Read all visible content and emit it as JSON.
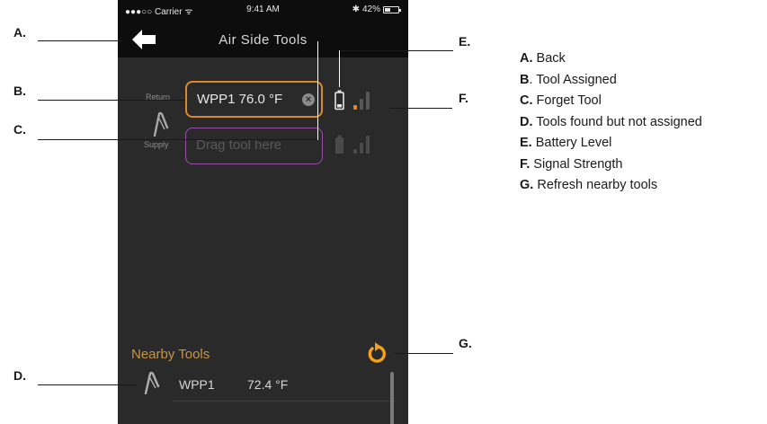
{
  "status_bar": {
    "carrier": "●●●○○ Carrier ᯤ",
    "time": "9:41 AM",
    "bluetooth": "✱",
    "battery_text": "42%",
    "battery_level": 0.42
  },
  "nav": {
    "title": "Air Side Tools"
  },
  "slots": {
    "return": {
      "label": "Return",
      "tool_text": "WPP1 76.0 °F",
      "battery_level": "low",
      "signal_bars_active": 1
    },
    "supply": {
      "label": "Supply",
      "placeholder": "Drag tool here",
      "battery_level": "empty",
      "signal_bars_active": 0
    }
  },
  "nearby": {
    "title": "Nearby Tools",
    "items": [
      {
        "name": "WPP1",
        "value": "72.4 °F"
      }
    ]
  },
  "callouts": {
    "a": "A.",
    "b": "B.",
    "c": "C.",
    "d": "D.",
    "e": "E.",
    "f": "F.",
    "g": "G."
  },
  "legend": [
    {
      "letter": "A.",
      "text": " Back"
    },
    {
      "letter": "B",
      "text": ". Tool Assigned"
    },
    {
      "letter": "C.",
      "text": " Forget Tool"
    },
    {
      "letter": "D.",
      "text": " Tools found but not assigned"
    },
    {
      "letter": "E.",
      "text": " Battery Level"
    },
    {
      "letter": "F.",
      "text": " Signal Strength"
    },
    {
      "letter": "G.",
      "text": " Refresh nearby tools"
    }
  ],
  "colors": {
    "screen_bg": "#2a2a2a",
    "bar_bg": "#0d0d0d",
    "accent_orange": "#d9892a",
    "accent_purple": "#9c4fa8",
    "nearby_title": "#c89540",
    "refresh": "#f4a21e"
  },
  "icons": {
    "back": "left-arrow-icon",
    "forget": "close-circle-icon",
    "battery": "battery-icon",
    "signal": "signal-strength-icon",
    "refresh": "refresh-icon",
    "tool": "probe-tool-icon"
  }
}
